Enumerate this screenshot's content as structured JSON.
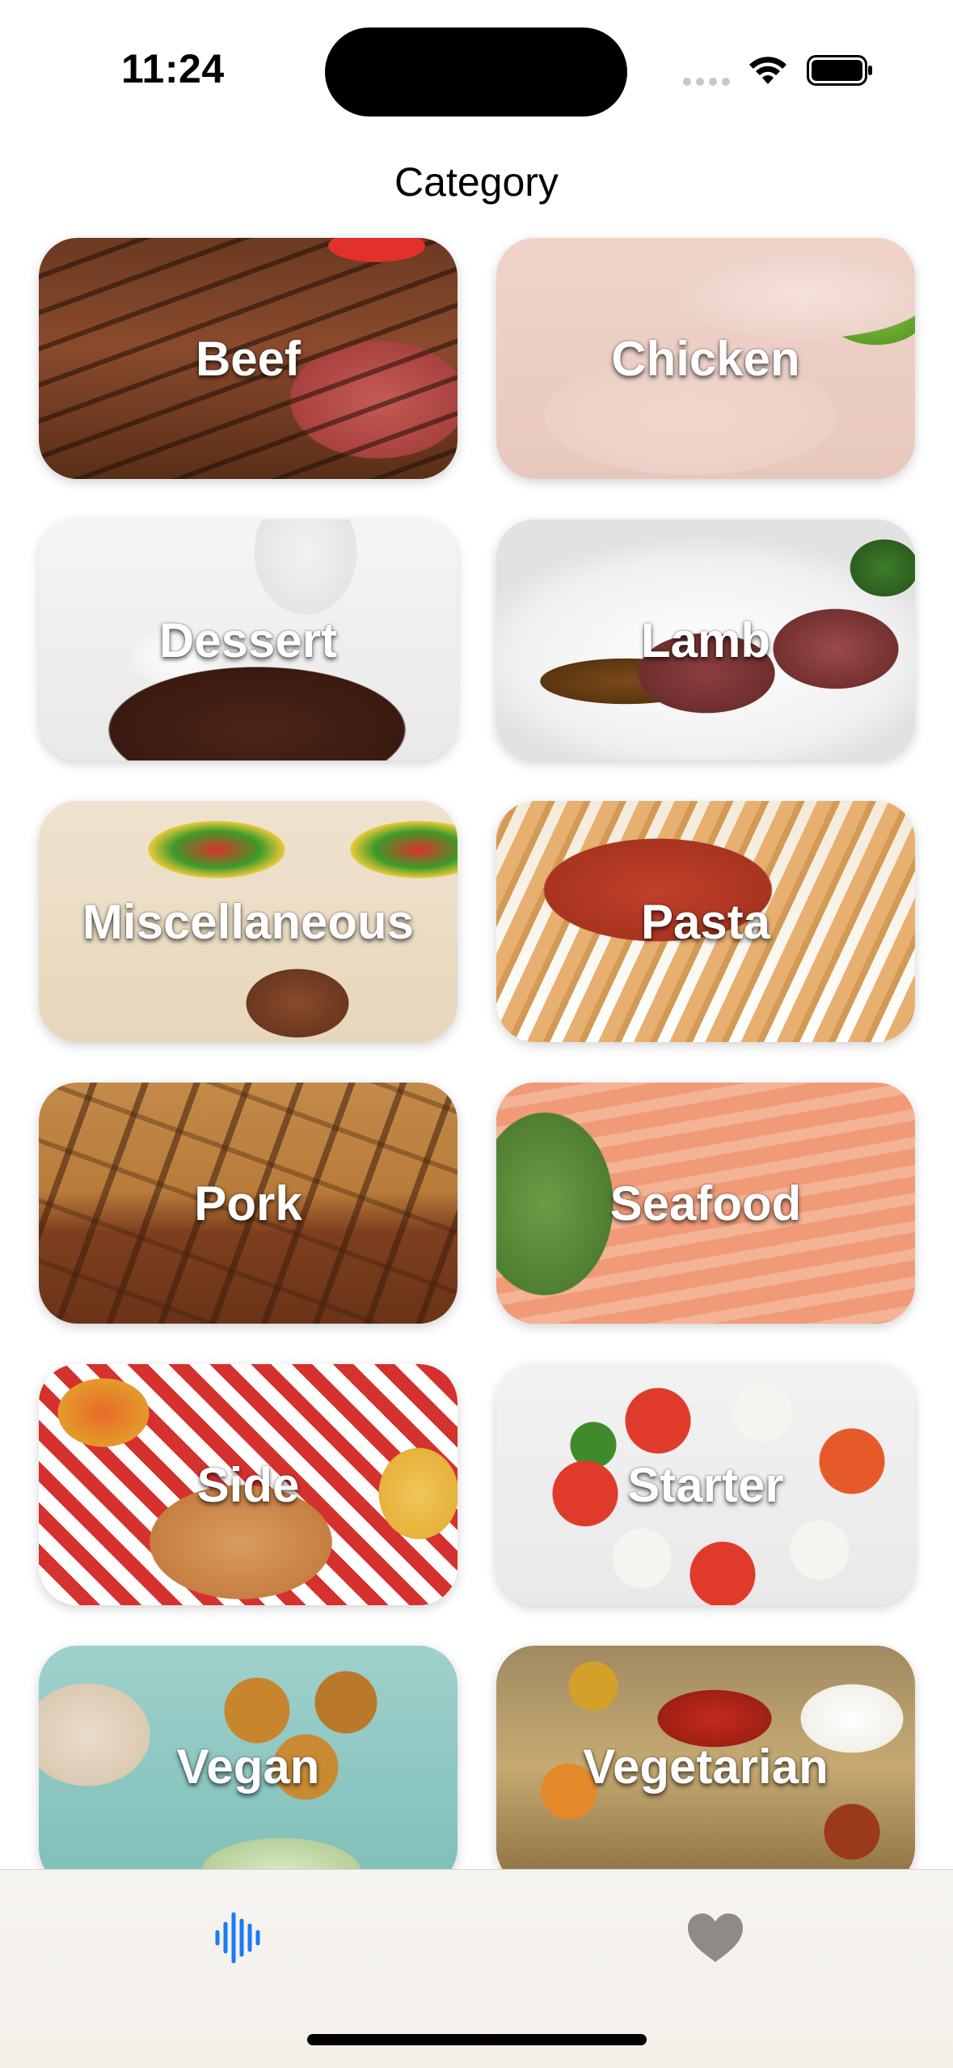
{
  "status_bar": {
    "time": "11:24"
  },
  "header": {
    "title": "Category"
  },
  "categories": [
    {
      "label": "Beef",
      "photo": "beef"
    },
    {
      "label": "Chicken",
      "photo": "chicken"
    },
    {
      "label": "Dessert",
      "photo": "dessert"
    },
    {
      "label": "Lamb",
      "photo": "lamb"
    },
    {
      "label": "Miscellaneous",
      "photo": "misc"
    },
    {
      "label": "Pasta",
      "photo": "pasta"
    },
    {
      "label": "Pork",
      "photo": "pork"
    },
    {
      "label": "Seafood",
      "photo": "seafood"
    },
    {
      "label": "Side",
      "photo": "side"
    },
    {
      "label": "Starter",
      "photo": "starter"
    },
    {
      "label": "Vegan",
      "photo": "vegan"
    },
    {
      "label": "Vegetarian",
      "photo": "vegetarian"
    }
  ],
  "tab_bar": {
    "tabs": [
      {
        "icon": "waveform-icon",
        "selected": true
      },
      {
        "icon": "heart-icon",
        "selected": false
      }
    ]
  },
  "colors": {
    "accent": "#1a7cf3",
    "inactive_tab": "#8e8a86"
  }
}
